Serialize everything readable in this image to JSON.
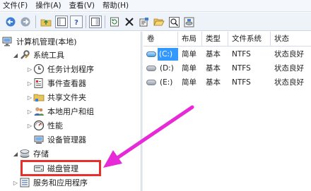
{
  "menubar": {
    "items": [
      "文件(F)",
      "操作(A)",
      "查看(V)",
      "帮助(H)"
    ]
  },
  "toolbar": {
    "buttons": [
      "back-icon",
      "forward-icon",
      "up-folder-icon",
      "show-tree-icon",
      "help-icon",
      "console-icon",
      "refresh-icon",
      "delete-icon",
      "properties-icon",
      "open-folder-icon",
      "search-icon",
      "disk-properties-icon"
    ]
  },
  "tree": {
    "root": "计算机管理(本地)",
    "system_tools": "系统工具",
    "task_scheduler": "任务计划程序",
    "event_viewer": "事件查看器",
    "shared_folders": "共享文件夹",
    "local_users": "本地用户和组",
    "performance": "性能",
    "device_manager": "设备管理器",
    "storage": "存储",
    "disk_management": "磁盘管理",
    "services_apps": "服务和应用程序"
  },
  "volumes": {
    "headers": [
      "卷",
      "布局",
      "类型",
      "文件系统",
      "状态"
    ],
    "rows": [
      {
        "volume": "(C:)",
        "layout": "简单",
        "type": "基本",
        "fs": "NTFS",
        "status": "状态良好"
      },
      {
        "volume": "(D:)",
        "layout": "简单",
        "type": "基本",
        "fs": "NTFS",
        "status": "状态良好"
      },
      {
        "volume": "(E:)",
        "layout": "简单",
        "type": "基本",
        "fs": "NTFS",
        "status": "状态良好"
      }
    ]
  },
  "colors": {
    "annotation_box": "#e8302a",
    "annotation_arrow": "#e62ad8",
    "selection": "#3399ff"
  }
}
